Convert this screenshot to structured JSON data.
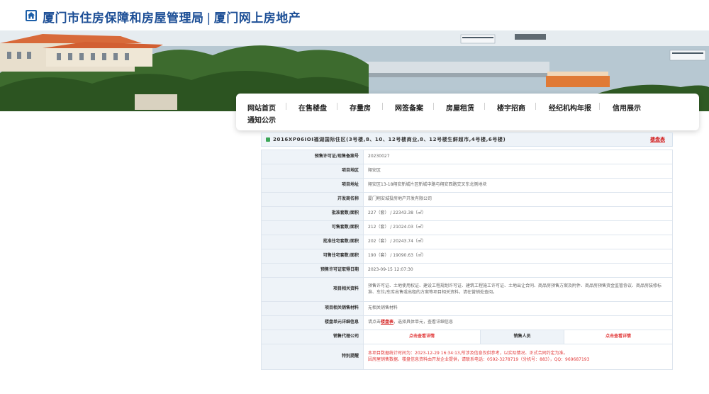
{
  "header": {
    "title_main": "厦门市住房保障和房屋管理局",
    "separator": "|",
    "title_sub": "厦门网上房地产"
  },
  "nav": {
    "items": [
      {
        "label": "网站首页"
      },
      {
        "label": "在售楼盘"
      },
      {
        "label": "存量房"
      },
      {
        "label": "网签备案"
      },
      {
        "label": "房屋租赁"
      },
      {
        "label": "楼宇招商"
      },
      {
        "label": "经纪机构年报"
      },
      {
        "label": "信用展示"
      },
      {
        "label": "通知公示"
      }
    ]
  },
  "project": {
    "name": "2016XP06IOI福湖国际住区(3号楼,8、10、12号楼商业,8、12号楼生鲜超市,4号楼,6号楼)",
    "table_link": "楼盘表"
  },
  "info": {
    "rows": [
      {
        "label": "预售许可证/现售备案号",
        "value": "20230027"
      },
      {
        "label": "项目地区",
        "value": "翔安区"
      },
      {
        "label": "项目地址",
        "value": "翔安区13-18翔安新城片区新城中路与翔安西路交叉东北侧地块"
      },
      {
        "label": "开发商名称",
        "value": "厦门翔安城投房地产开发有限公司"
      },
      {
        "label": "批准套数/面积",
        "value": "227（套） / 22343.38（㎡）"
      },
      {
        "label": "可售套数/面积",
        "value": "212（套） / 21024.03（㎡）"
      },
      {
        "label": "批准住宅套数/面积",
        "value": "202（套） / 20243.74（㎡）"
      },
      {
        "label": "可售住宅套数/面积",
        "value": "190（套） / 19090.63（㎡）"
      },
      {
        "label": "预售许可证取得日期",
        "value": "2023-09-15 12:07:30"
      },
      {
        "label": "项目相关资料",
        "value": "预售许可证、土地使用权证、建设工程规划许可证、建筑工程施工许可证、土地出让合同、商品房预售方案及附件、商品房预售资金监管协议、商品房装修标准、车位/车库出售或出租的方案等项目相关资料，请在营销处查阅。"
      },
      {
        "label": "项目相关销售材料",
        "value": "无相关销售材料"
      },
      {
        "label": "楼盘单元详细信息",
        "value_prefix": "请点击",
        "value_link": "楼盘表",
        "value_suffix": "，选择具体单元，查看详细信息"
      }
    ],
    "agency_label": "销售代理公司",
    "agency_value": "点击查看详情",
    "sales_label": "销售人员",
    "sales_value": "点击查看详情",
    "special_label": "特别提醒",
    "special_line1": "本项目数据统计时间为：2023-12-29 16:34:13,所涉及信息仅供参考，以实际情况、正式合同约定为准。",
    "special_line2": "因房屋销售数据、楼盘信息资料由开发企业提供，请联系电话：0592-3278719（分机号：883），QQ：969687193"
  }
}
